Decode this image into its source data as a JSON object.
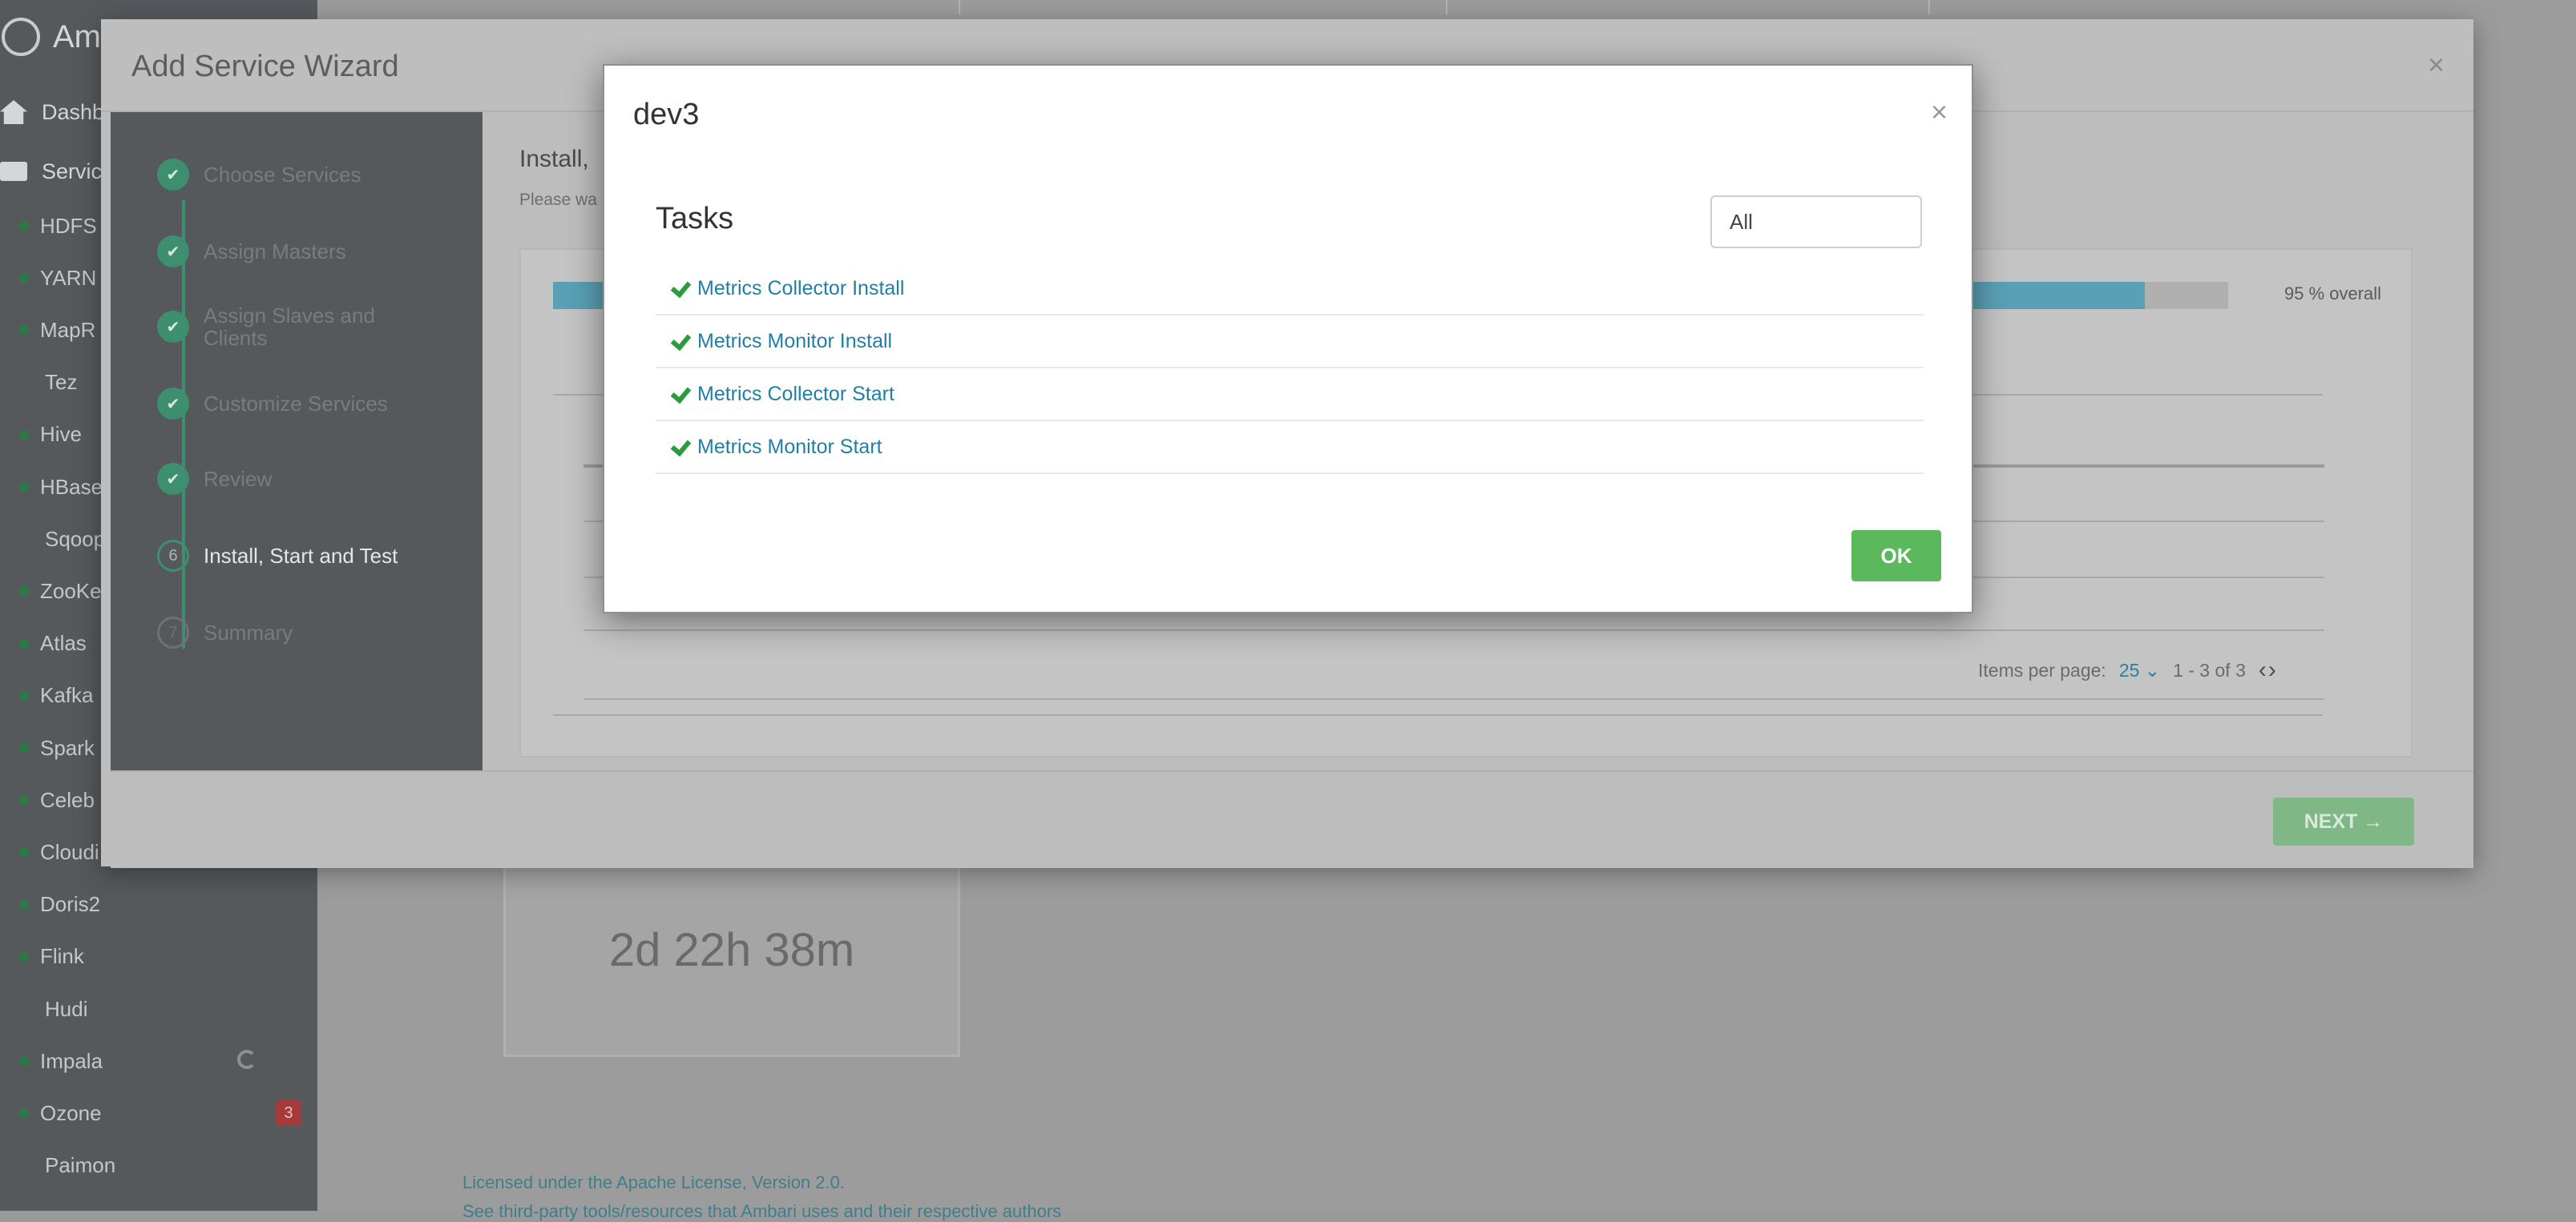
{
  "app": {
    "brand": "Am"
  },
  "sidebar": {
    "top_items": [
      {
        "label": "Dashb"
      },
      {
        "label": "Servic"
      }
    ],
    "services": [
      {
        "label": "HDFS",
        "dot": true
      },
      {
        "label": "YARN",
        "dot": true
      },
      {
        "label": "MapR",
        "dot": true
      },
      {
        "label": "Tez",
        "dot": false
      },
      {
        "label": "Hive",
        "dot": true
      },
      {
        "label": "HBase",
        "dot": true
      },
      {
        "label": "Sqoop",
        "dot": false
      },
      {
        "label": "ZooKe",
        "dot": true
      },
      {
        "label": "Atlas",
        "dot": true
      },
      {
        "label": "Kafka",
        "dot": true
      },
      {
        "label": "Spark",
        "dot": true
      },
      {
        "label": "Celeb",
        "dot": true
      },
      {
        "label": "Cloudi",
        "dot": true
      },
      {
        "label": "Doris2",
        "dot": true
      },
      {
        "label": "Flink",
        "dot": true
      },
      {
        "label": "Hudi",
        "dot": false
      },
      {
        "label": "Impala",
        "dot": true
      },
      {
        "label": "Ozone",
        "dot": true,
        "badge": "3"
      },
      {
        "label": "Paimon",
        "dot": false
      }
    ]
  },
  "background": {
    "card_value": "2d 22h 38m",
    "footer_line1": "Licensed under the Apache License, Version 2.0.",
    "footer_line2": "See third-party tools/resources that Ambari uses and their respective authors"
  },
  "wizard": {
    "title": "Add Service Wizard",
    "close": "×",
    "steps": [
      {
        "num": "✔",
        "label": "Choose Services",
        "state": "done"
      },
      {
        "num": "✔",
        "label": "Assign Masters",
        "state": "done"
      },
      {
        "num": "✔",
        "label": "Assign Slaves and Clients",
        "state": "done"
      },
      {
        "num": "✔",
        "label": "Customize Services",
        "state": "done"
      },
      {
        "num": "✔",
        "label": "Review",
        "state": "done"
      },
      {
        "num": "6",
        "label": "Install, Start and Test",
        "state": "current"
      },
      {
        "num": "7",
        "label": "Summary",
        "state": "todo"
      }
    ],
    "content_title": "Install,",
    "content_subtitle": "Please wa",
    "progress": {
      "percent": 95,
      "label": "95 % overall"
    },
    "pager": {
      "items_per_page_label": "Items per page:",
      "per_page": "25",
      "range": "1 - 3 of 3",
      "arrows": "‹›"
    },
    "next_label": "NEXT →"
  },
  "dialog": {
    "title": "dev3",
    "close": "×",
    "tasks_heading": "Tasks",
    "filter_value": "All",
    "tasks": [
      {
        "label": "Metrics Collector Install"
      },
      {
        "label": "Metrics Monitor Install"
      },
      {
        "label": "Metrics Collector Start"
      },
      {
        "label": "Metrics Monitor Start"
      }
    ],
    "ok_label": "OK"
  },
  "colors": {
    "ok_button": "#5cb85c",
    "task_link": "#1f7fa6",
    "check": "#2a9c3e",
    "step_done": "#3d8f70"
  }
}
